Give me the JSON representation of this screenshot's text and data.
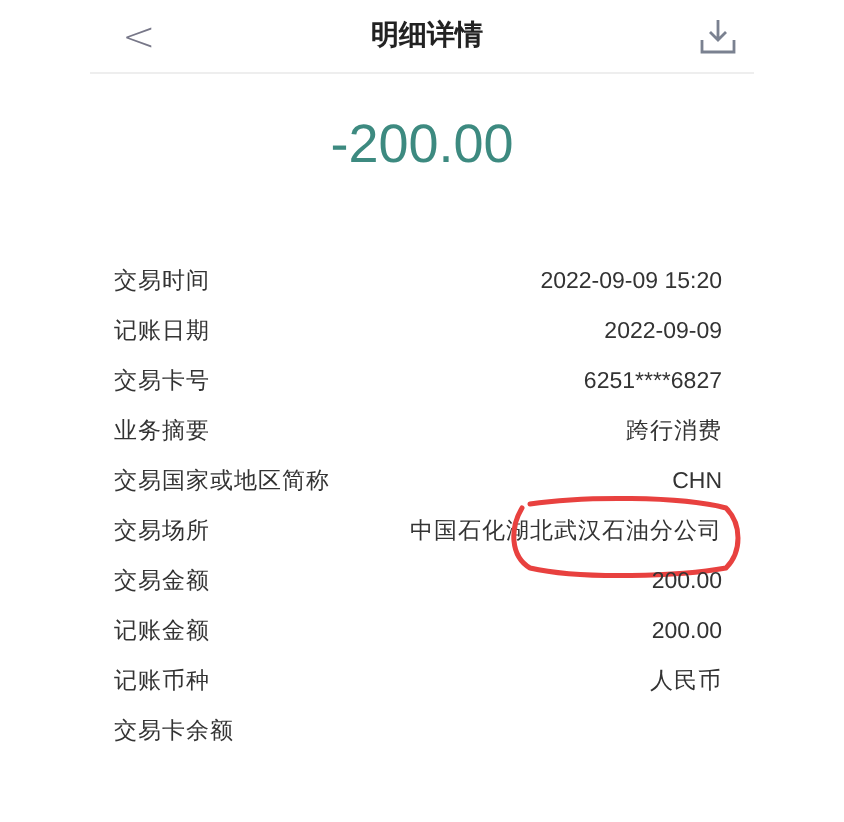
{
  "header": {
    "back": "<",
    "title": "明细详情"
  },
  "amount": "-200.00",
  "rows": [
    {
      "label": "交易时间",
      "value": "2022-09-09 15:20"
    },
    {
      "label": "记账日期",
      "value": "2022-09-09"
    },
    {
      "label": "交易卡号",
      "value": "6251****6827"
    },
    {
      "label": "业务摘要",
      "value": "跨行消费"
    },
    {
      "label": "交易国家或地区简称",
      "value": "CHN"
    },
    {
      "label": "交易场所",
      "value": "中国石化湖北武汉石油分公司",
      "circled": true
    },
    {
      "label": "交易金额",
      "value": "200.00"
    },
    {
      "label": "记账金额",
      "value": "200.00"
    },
    {
      "label": "记账币种",
      "value": "人民币"
    },
    {
      "label": "交易卡余额"
    }
  ]
}
